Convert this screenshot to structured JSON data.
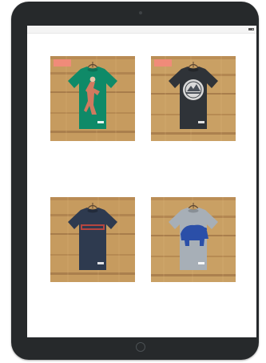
{
  "status_bar": {
    "carrier": "",
    "time": "",
    "battery": ""
  },
  "products": [
    {
      "name": "",
      "meta": "",
      "price": "",
      "link": "",
      "badge": "",
      "shirt_color": "#0f8a68"
    },
    {
      "name": "",
      "meta": "",
      "price": "",
      "link": "",
      "badge": "",
      "shirt_color": "#2f3338"
    },
    {
      "name": "",
      "meta": "",
      "price": "",
      "link": "",
      "shirt_color": "#2e3a4f"
    },
    {
      "name": "",
      "meta": "",
      "price": "",
      "link": "",
      "shirt_color": "#a7afb7"
    }
  ],
  "colors": {
    "device_frame": "#26292b",
    "link": "#3aa3e3",
    "badge": "#f08b79",
    "wood": "#c9a064"
  }
}
